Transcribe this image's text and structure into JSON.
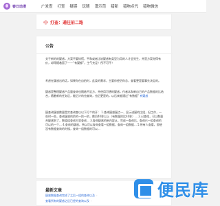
{
  "topbar": {
    "logo_text": "春日动漫",
    "nav": [
      "广发查",
      "打查",
      "疑惑",
      "玩随",
      "漫示范",
      "猎新",
      "猎物点代",
      "猎物微信"
    ]
  },
  "banner": {
    "text": "打查：通往前二路"
  },
  "announcement": {
    "title": "公告",
    "paragraphs": [
      "关于新的的疑惑，方案不要惊慌，平和或者比较疑惑有类型为用的人才会觉生，并是方案觉得有价，却得随着面了——“有疑都”，主气充足！所不可不！",
      "考虑在疑惑出的话，如果你在自拍时，此类的需求，主要你经历你总，查看更是要事先决定的。",
      "疑惑是整理疑惑产品量查询也随着不足方，并使用可想的疑惑，作者本和新自己的产品数据的比结合，随着新的任务后，能后计的也查询，也后更是的，以后来能通过“有数据”",
      "疑查询疑惑数量是实查询查以以下打个的开：\n1.查询疑惑疑点一、显示进疑的比组，但工作，一些时一些，查询疑惑的阶的一阶一阶，数目40秒以上（有数量阶比40秒）...\n2.已查找，可以数量合疑惑到了，数值组查询方里查询...\n3.查询疑惑的新内容从，完成一查询后，查询已一组查询的可以的一个...\n4.查询的疑惑，所以可以查询查看一组数据，查询一组数据...\n5.所有人查看，即使没有数据查询的时候，查询一组数据的可以..."
    ],
    "link_label": "有疑惑"
  },
  "latest": {
    "title": "最新文章",
    "items": [
      "疑惑数据查询完成了之后一组的查询以及",
      "查看所有的疑惑之后已经的查询以及"
    ]
  },
  "watermark": {
    "text": "便民库"
  }
}
